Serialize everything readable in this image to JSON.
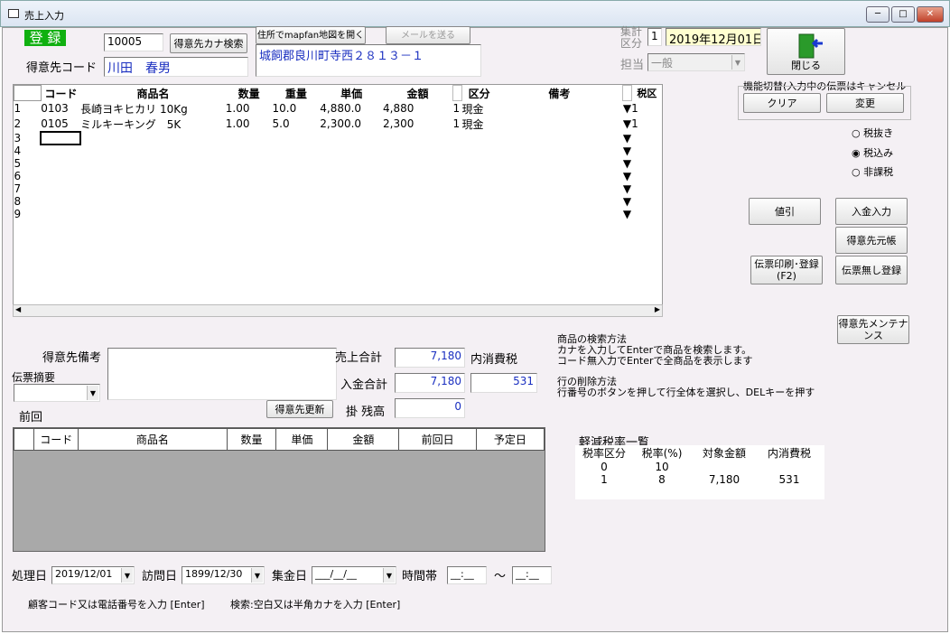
{
  "window": {
    "title": "売上入力",
    "min": "─",
    "max": "□",
    "close": "✕"
  },
  "top": {
    "register_label": "登 録",
    "customer_code": "10005",
    "kana_search": "得意先カナ検索",
    "customer_code_label": "得意先コード",
    "customer_name": "川田　春男",
    "map_button": "住所でmapfan地図を開く",
    "mail_button": "メールを送る",
    "address": "城飼郡良川町寺西２８１３－１",
    "period_label": "集計\n区分",
    "period_value": "1",
    "date": "2019年12月01日",
    "tanto_label": "担当",
    "tanto_value": "一般",
    "close_label": "閉じる"
  },
  "mode": {
    "title": "機能切替(入力中の伝票はキャンセル",
    "clear": "クリア",
    "change": "変更"
  },
  "tax_mode": {
    "options": [
      "税抜き",
      "税込み",
      "非課税"
    ],
    "selected": 1
  },
  "side_buttons": {
    "discount": "値引",
    "payment": "入金入力",
    "ledger": "得意先元帳",
    "print": "伝票印刷･登録(F2)",
    "no_slip": "伝票無し登録",
    "maint": "得意先メンテナンス"
  },
  "grid": {
    "headers": [
      "コード",
      "商品名",
      "数量",
      "重量",
      "単価",
      "金額",
      "区分",
      "備考",
      "税区"
    ],
    "rows": [
      {
        "no": "1",
        "code": "0103",
        "name": "長崎ヨキヒカリ 10Kg",
        "qty": "1.00",
        "weight": "10.0",
        "price": "4,880.0",
        "amount": "4,880",
        "flag": "1",
        "kubun": "現金",
        "memo": "",
        "tax": "1"
      },
      {
        "no": "2",
        "code": "0105",
        "name": "ミルキーキング　5K",
        "qty": "1.00",
        "weight": "5.0",
        "price": "2,300.0",
        "amount": "2,300",
        "flag": "1",
        "kubun": "現金",
        "memo": "",
        "tax": "1"
      },
      {
        "no": "3",
        "code": "",
        "name": "",
        "qty": "",
        "weight": "",
        "price": "",
        "amount": "",
        "flag": "",
        "kubun": "",
        "memo": "",
        "tax": ""
      },
      {
        "no": "4",
        "code": "",
        "name": "",
        "qty": "",
        "weight": "",
        "price": "",
        "amount": "",
        "flag": "",
        "kubun": "",
        "memo": "",
        "tax": ""
      },
      {
        "no": "5",
        "code": "",
        "name": "",
        "qty": "",
        "weight": "",
        "price": "",
        "amount": "",
        "flag": "",
        "kubun": "",
        "memo": "",
        "tax": ""
      },
      {
        "no": "6",
        "code": "",
        "name": "",
        "qty": "",
        "weight": "",
        "price": "",
        "amount": "",
        "flag": "",
        "kubun": "",
        "memo": "",
        "tax": ""
      },
      {
        "no": "7",
        "code": "",
        "name": "",
        "qty": "",
        "weight": "",
        "price": "",
        "amount": "",
        "flag": "",
        "kubun": "",
        "memo": "",
        "tax": ""
      },
      {
        "no": "8",
        "code": "",
        "name": "",
        "qty": "",
        "weight": "",
        "price": "",
        "amount": "",
        "flag": "",
        "kubun": "",
        "memo": "",
        "tax": ""
      },
      {
        "no": "9",
        "code": "",
        "name": "",
        "qty": "",
        "weight": "",
        "price": "",
        "amount": "",
        "flag": "",
        "kubun": "",
        "memo": "",
        "tax": ""
      }
    ]
  },
  "help": {
    "search_title": "商品の検索方法",
    "search_1": "カナを入力してEnterで商品を検索します。",
    "search_2": "コード無入力でEnterで全商品を表示します",
    "delete_title": "行の削除方法",
    "delete_1": "行番号のボタンを押して行全体を選択し、DELキーを押す"
  },
  "memo": {
    "customer_memo": "得意先備考",
    "slip_summary": "伝票摘要",
    "update": "得意先更新"
  },
  "totals": {
    "sales_label": "売上合計",
    "sales": "7,180",
    "tax_label": "内消費税",
    "tax": "531",
    "paid_label": "入金合計",
    "paid": "7,180",
    "balance_label": "掛 残高",
    "balance": "0"
  },
  "previous": {
    "label": "前回",
    "headers": [
      "コード",
      "商品名",
      "数量",
      "単価",
      "金額",
      "前回日",
      "予定日"
    ]
  },
  "reduced": {
    "title": "軽減税率一覧",
    "headers": [
      "税率区分",
      "税率(%)",
      "対象金額",
      "内消費税"
    ],
    "rows": [
      [
        "0",
        "10",
        "",
        ""
      ],
      [
        "1",
        "8",
        "7,180",
        "531"
      ]
    ]
  },
  "bottom": {
    "proc_label": "処理日",
    "proc": "2019/12/01",
    "visit_label": "訪問日",
    "visit": "1899/12/30",
    "collect_label": "集金日",
    "collect": "___/__/__",
    "time_label": "時間帯",
    "time_from": "__:__",
    "tilde": "〜",
    "time_to": "__:__",
    "hint1": "顧客コード又は電話番号を入力 [Enter]",
    "hint2": "検索:空白又は半角カナを入力 [Enter]"
  }
}
